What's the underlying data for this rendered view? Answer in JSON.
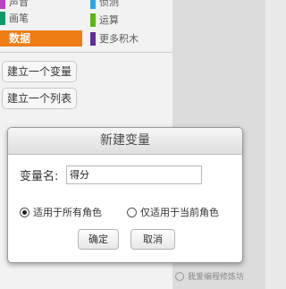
{
  "categories": [
    {
      "label": "声音",
      "color": "#bb42c3"
    },
    {
      "label": "画笔",
      "color": "#0e9a6c"
    },
    {
      "label": "数据",
      "color": "#ee7d16"
    },
    {
      "label": "侦测",
      "color": "#2ca5e2"
    },
    {
      "label": "运算",
      "color": "#5cb712"
    },
    {
      "label": "更多积木",
      "color": "#632d99"
    }
  ],
  "buttons": {
    "make_variable": "建立一个变量",
    "make_list": "建立一个列表"
  },
  "dialog": {
    "title": "新建变量",
    "name_label": "变量名:",
    "name_value": "得分",
    "option_all_sprites": "适用于所有角色",
    "option_this_sprite": "仅适用于当前角色",
    "ok": "确定",
    "cancel": "取消"
  },
  "watermark": "我爱编程修炼坊"
}
